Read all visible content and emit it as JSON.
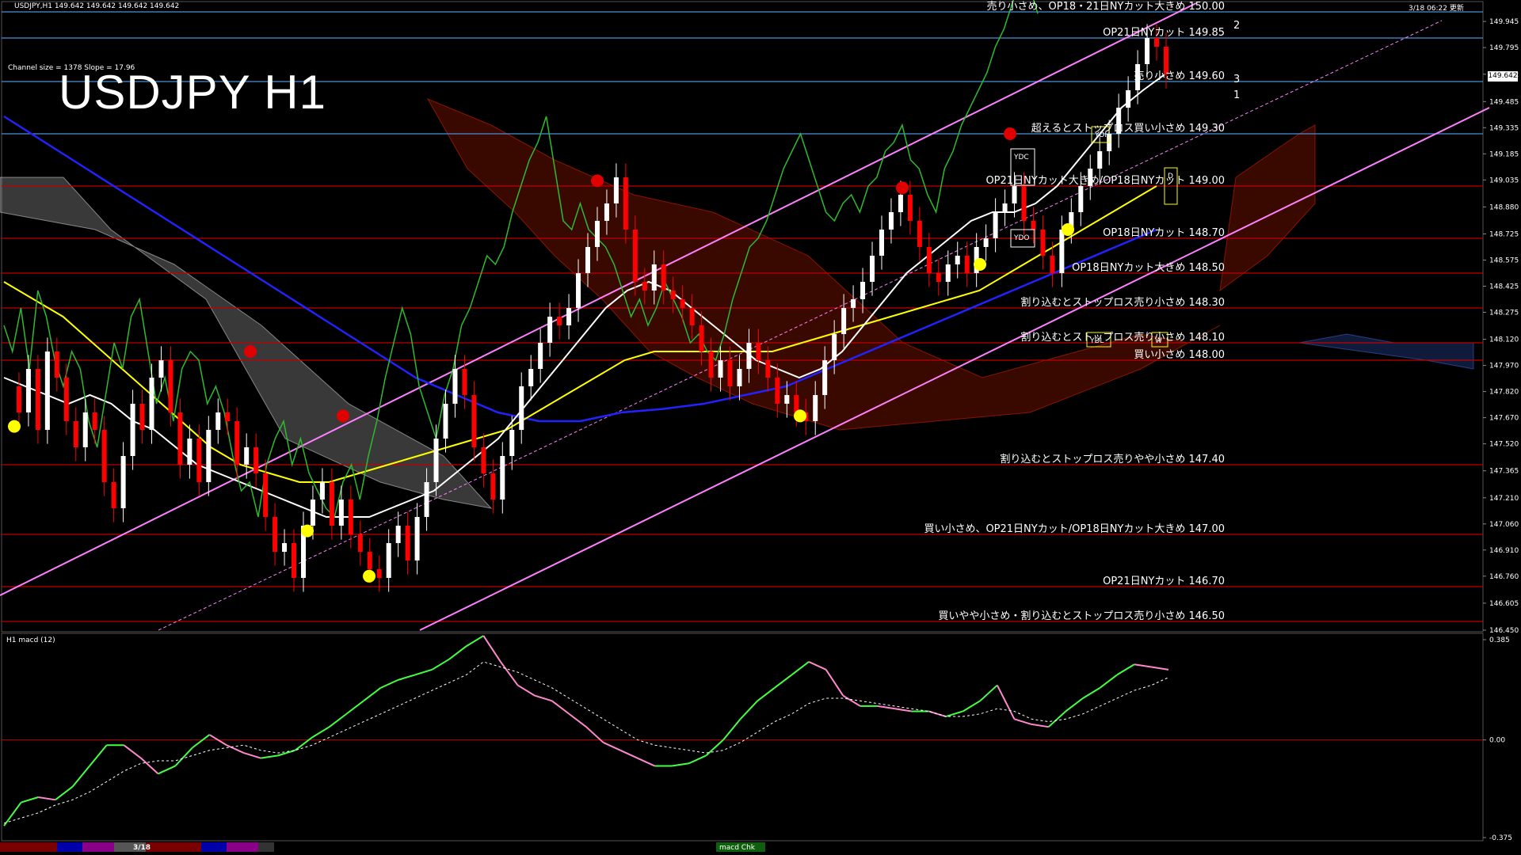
{
  "header": {
    "symbol_line": "USDJPY,H1  149.642 149.642 149.642 149.642",
    "timestamp": "3/18 06:22 更新",
    "channel_info": "Channel size = 1378 Slope = 17.96",
    "big_title": "USDJPY H1"
  },
  "current_price": "149.642",
  "macd_label": "H1  macd (12)",
  "bottom_bar": {
    "date": "3/18",
    "status": "macd Chk"
  },
  "colors": {
    "background": "#000000",
    "bull_candle": "#ffffff",
    "bear_candle": "#ff0000",
    "channel": "#ff80ff",
    "level_line": "#c00000",
    "blue_line": "#4a8fd8",
    "ma_white": "#ffffff",
    "ma_yellow": "#ffff00",
    "ma_blue": "#2222ff",
    "chikou_green": "#2ebb2e",
    "macd_up": "#44ff44",
    "macd_down": "#ff88cc",
    "cloud_red": "#cc2200",
    "cloud_white": "#cccccc"
  },
  "chart_data": [
    {
      "type": "line",
      "title": "USDJPY H1",
      "subtitle": "Channel size = 1378 Slope = 17.96",
      "ylim": [
        146.45,
        150.05
      ],
      "price_ticks": [
        "149.945",
        "149.795",
        "149.642",
        "149.485",
        "149.335",
        "149.185",
        "149.035",
        "148.880",
        "148.725",
        "148.575",
        "148.425",
        "148.275",
        "148.120",
        "147.970",
        "147.820",
        "147.670",
        "147.520",
        "147.365",
        "147.210",
        "147.060",
        "146.910",
        "146.760",
        "146.605",
        "146.450"
      ],
      "levels": [
        {
          "price": 150.0,
          "text": "売り小さめ、OP18・21日NYカット大きめ 150.00",
          "color": "blue"
        },
        {
          "price": 149.85,
          "text": "OP21日NYカット 149.85",
          "color": "blue"
        },
        {
          "price": 149.6,
          "text": "売り小さめ 149.60",
          "color": "blue"
        },
        {
          "price": 149.3,
          "text": "超えるとストップロス買い小さめ 149.30",
          "color": "blue"
        },
        {
          "price": 149.0,
          "text": "OP21日NYカット大きめ/OP18日NYカット 149.00",
          "color": "red"
        },
        {
          "price": 148.7,
          "text": "OP18日NYカット 148.70",
          "color": "red"
        },
        {
          "price": 148.5,
          "text": "OP18日NYカット大きめ 148.50",
          "color": "red"
        },
        {
          "price": 148.3,
          "text": "割り込むとストップロス売り小さめ 148.30",
          "color": "red"
        },
        {
          "price": 148.1,
          "text": "割り込むとストップロス売り小さめ 148.10",
          "color": "red"
        },
        {
          "price": 148.0,
          "text": "買い小さめ 148.00",
          "color": "red"
        },
        {
          "price": 147.4,
          "text": "割り込むとストップロス売りやや小さめ 147.40",
          "color": "red"
        },
        {
          "price": 147.0,
          "text": "買い小さめ、OP21日NYカット/OP18日NYカット大きめ 147.00",
          "color": "red"
        },
        {
          "price": 146.7,
          "text": "OP21日NYカット 146.70",
          "color": "red"
        },
        {
          "price": 146.5,
          "text": "買いやや小さめ・割り込むとストップロス売り小さめ 146.50",
          "color": "red"
        }
      ],
      "box_labels": [
        "YDC",
        "YDO",
        "YDH",
        "YDL",
        "W",
        "D",
        "1",
        "2",
        "3"
      ],
      "series": [
        {
          "values": [
            147.85,
            147.7,
            147.95,
            147.6,
            148.05,
            147.9,
            147.65,
            147.5,
            147.7,
            147.6,
            147.3,
            147.15,
            147.45,
            147.75,
            147.6,
            147.9,
            148.0,
            147.7,
            147.4,
            147.55,
            147.3,
            147.6,
            147.7,
            147.65,
            147.4,
            147.5,
            147.35,
            147.1,
            146.9,
            146.95,
            146.75,
            147.05,
            147.2,
            147.3,
            147.05,
            147.2,
            147.0,
            146.9,
            146.8,
            146.75,
            146.95,
            147.05,
            146.85,
            147.1,
            147.3,
            147.55,
            147.75,
            147.95,
            147.8,
            147.5,
            147.35,
            147.2,
            147.45,
            147.6,
            147.85,
            147.95,
            148.1,
            148.25,
            148.2,
            148.3,
            148.5,
            148.65,
            148.8,
            148.9,
            149.05,
            148.75,
            148.45,
            148.4,
            148.55,
            148.4,
            148.35,
            148.3,
            148.2,
            148.05,
            147.9,
            148.0,
            147.85,
            147.95,
            148.1,
            148.0,
            147.9,
            147.75,
            147.8,
            147.7,
            147.65,
            147.8,
            148.0,
            148.15,
            148.3,
            148.35,
            148.45,
            148.6,
            148.75,
            148.85,
            148.95,
            148.8,
            148.65,
            148.5,
            148.45,
            148.55,
            148.6,
            148.5,
            148.65,
            148.7,
            148.85,
            148.9,
            149.0,
            148.8,
            148.75,
            148.6,
            148.5,
            148.75,
            148.85,
            149.0,
            149.1,
            149.2,
            149.3,
            149.45,
            149.55,
            149.7,
            149.85,
            149.8,
            149.64
          ]
        },
        {
          "values": [
            147.9,
            147.85,
            147.8,
            147.75,
            147.8,
            147.75,
            147.65,
            147.6,
            147.5,
            147.4,
            147.35,
            147.3,
            147.25,
            147.2,
            147.15,
            147.1,
            147.1,
            147.1,
            147.15,
            147.2,
            147.25,
            147.35,
            147.45,
            147.55,
            147.7,
            147.85,
            148.0,
            148.15,
            148.3,
            148.4,
            148.45,
            148.4,
            148.3,
            148.2,
            148.1,
            148.0,
            147.95,
            147.9,
            147.95,
            148.05,
            148.2,
            148.35,
            148.5,
            148.6,
            148.7,
            148.8,
            148.85,
            148.85,
            148.9,
            149.0,
            149.15,
            149.3,
            149.45,
            149.55,
            149.64
          ]
        },
        {
          "values": [
            148.45,
            148.35,
            148.25,
            148.1,
            147.95,
            147.8,
            147.65,
            147.5,
            147.4,
            147.35,
            147.3,
            147.3,
            147.35,
            147.4,
            147.45,
            147.5,
            147.55,
            147.6,
            147.7,
            147.8,
            147.9,
            148.0,
            148.05,
            148.05,
            148.05,
            148.05,
            148.05,
            148.1,
            148.15,
            148.2,
            148.25,
            148.3,
            148.35,
            148.4,
            148.5,
            148.6,
            148.7,
            148.8,
            148.9,
            149.0
          ]
        },
        {
          "values": [
            149.4,
            149.25,
            149.1,
            148.95,
            148.8,
            148.65,
            148.5,
            148.35,
            148.2,
            148.05,
            147.9,
            147.8,
            147.7,
            147.65,
            147.65,
            147.7,
            147.72,
            147.75,
            147.8,
            147.85,
            147.95,
            148.05,
            148.15,
            148.25,
            148.35,
            148.45,
            148.55,
            148.65,
            148.75
          ]
        }
      ]
    },
    {
      "type": "line",
      "title": "H1  macd (12)",
      "ylim": [
        -0.375,
        0.385
      ],
      "price_ticks": [
        "0.385",
        "0.00",
        "-0.375"
      ],
      "series": [
        {
          "values": [
            -0.33,
            -0.24,
            -0.22,
            -0.23,
            -0.18,
            -0.1,
            -0.02,
            -0.02,
            -0.07,
            -0.13,
            -0.1,
            -0.03,
            0.02,
            -0.02,
            -0.05,
            -0.07,
            -0.06,
            -0.04,
            0.01,
            0.05,
            0.1,
            0.15,
            0.2,
            0.23,
            0.25,
            0.27,
            0.31,
            0.36,
            0.4,
            0.3,
            0.21,
            0.17,
            0.15,
            0.1,
            0.05,
            -0.01,
            -0.04,
            -0.07,
            -0.1,
            -0.1,
            -0.09,
            -0.06,
            0.0,
            0.08,
            0.15,
            0.2,
            0.25,
            0.3,
            0.27,
            0.17,
            0.13,
            0.13,
            0.12,
            0.11,
            0.11,
            0.09,
            0.11,
            0.15,
            0.21,
            0.08,
            0.06,
            0.05,
            0.11,
            0.16,
            0.2,
            0.25,
            0.29,
            0.28,
            0.27
          ]
        },
        {
          "values": [
            -0.32,
            -0.3,
            -0.28,
            -0.25,
            -0.23,
            -0.2,
            -0.16,
            -0.12,
            -0.09,
            -0.08,
            -0.08,
            -0.06,
            -0.04,
            -0.03,
            -0.02,
            -0.04,
            -0.05,
            -0.04,
            -0.02,
            0.01,
            0.04,
            0.07,
            0.1,
            0.13,
            0.16,
            0.19,
            0.22,
            0.25,
            0.3,
            0.28,
            0.26,
            0.23,
            0.2,
            0.16,
            0.12,
            0.08,
            0.04,
            0.0,
            -0.02,
            -0.03,
            -0.04,
            -0.05,
            -0.04,
            -0.01,
            0.03,
            0.07,
            0.1,
            0.14,
            0.16,
            0.16,
            0.15,
            0.14,
            0.13,
            0.12,
            0.11,
            0.09,
            0.09,
            0.1,
            0.12,
            0.11,
            0.08,
            0.07,
            0.08,
            0.1,
            0.13,
            0.16,
            0.19,
            0.21,
            0.24
          ]
        }
      ]
    }
  ]
}
